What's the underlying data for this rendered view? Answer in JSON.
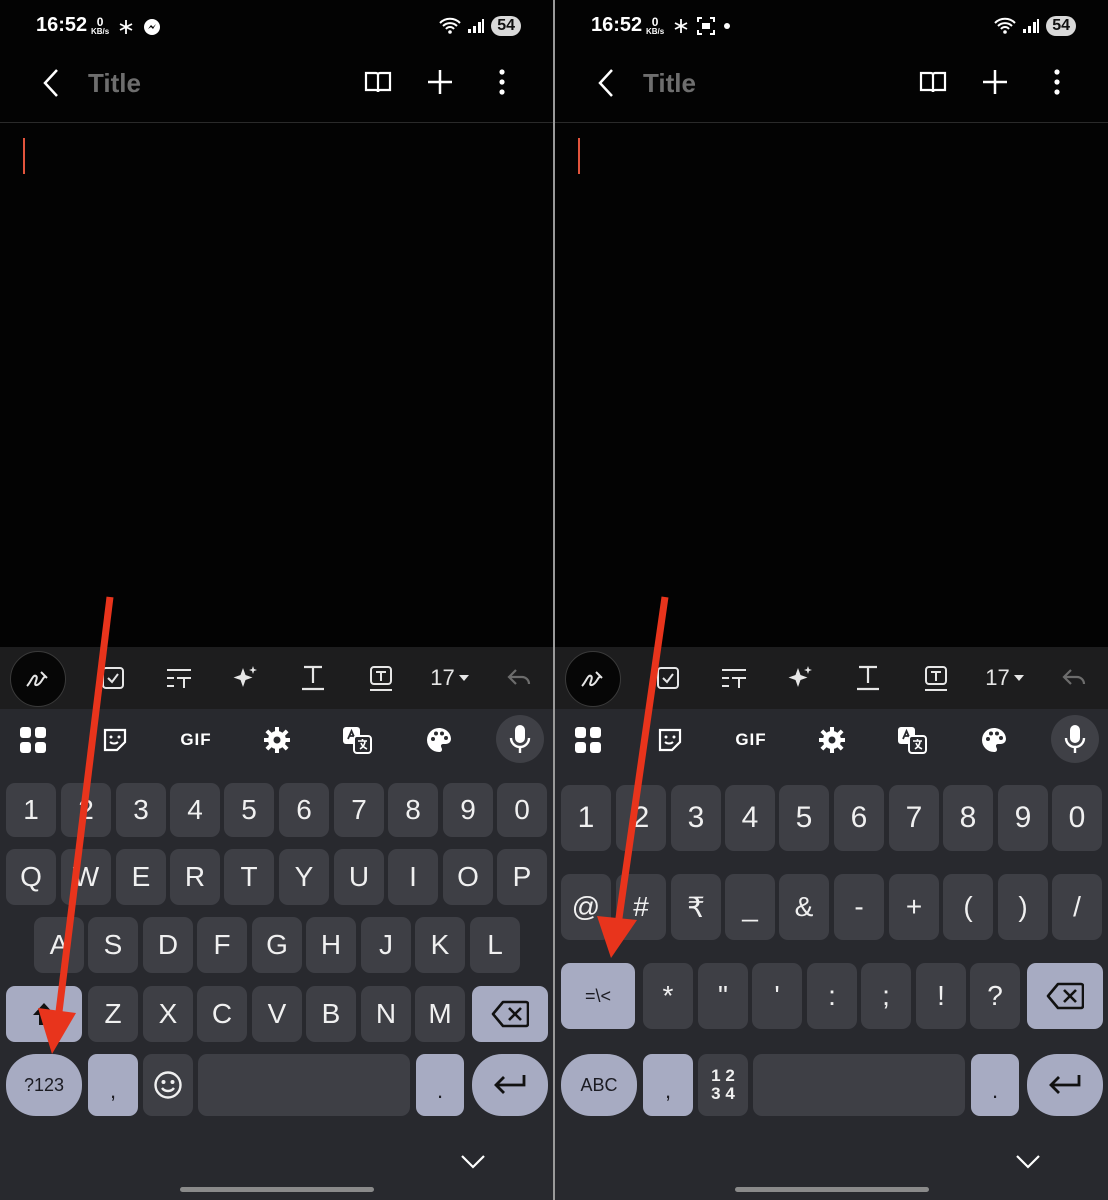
{
  "panels": [
    {
      "status": {
        "time": "16:52",
        "speed_value": "0",
        "speed_unit": "KB/s",
        "battery": "54"
      },
      "app_bar": {
        "title": "Title"
      },
      "toolbar": {
        "font_size": "17"
      },
      "kb_toolbar": {
        "gif_label": "GIF"
      },
      "keyboard_layout": "alphabet",
      "rows": {
        "numbers": [
          "1",
          "2",
          "3",
          "4",
          "5",
          "6",
          "7",
          "8",
          "9",
          "0"
        ],
        "row1": [
          "Q",
          "W",
          "E",
          "R",
          "T",
          "Y",
          "U",
          "I",
          "O",
          "P"
        ],
        "row2": [
          "A",
          "S",
          "D",
          "F",
          "G",
          "H",
          "J",
          "K",
          "L"
        ],
        "row3": [
          "Z",
          "X",
          "C",
          "V",
          "B",
          "N",
          "M"
        ]
      },
      "bottom": {
        "mode_key": "?123",
        "comma": ",",
        "period": "."
      }
    },
    {
      "status": {
        "time": "16:52",
        "speed_value": "0",
        "speed_unit": "KB/s",
        "battery": "54"
      },
      "app_bar": {
        "title": "Title"
      },
      "toolbar": {
        "font_size": "17"
      },
      "kb_toolbar": {
        "gif_label": "GIF"
      },
      "keyboard_layout": "symbols",
      "rows": {
        "numbers": [
          "1",
          "2",
          "3",
          "4",
          "5",
          "6",
          "7",
          "8",
          "9",
          "0"
        ],
        "row1": [
          "@",
          "#",
          "₹",
          "_",
          "&",
          "-",
          "+",
          "(",
          ")",
          "/"
        ],
        "row2": [
          "*",
          "\"",
          "'",
          ":",
          ";",
          "!",
          "?"
        ]
      },
      "bottom": {
        "mode_key": "ABC",
        "shift_key": "=\\<",
        "comma": ",",
        "numpad_top": "1 2",
        "numpad_bottom": "3 4",
        "period": "."
      }
    }
  ],
  "colors": {
    "accent_arrow": "#e8341c",
    "cursor": "#e2543c",
    "function_key": "#a7abc2",
    "key": "#3e3f45",
    "keyboard_bg": "#28292e"
  },
  "icons": [
    "back-chevron-icon",
    "reader-mode-icon",
    "add-icon",
    "more-vert-icon",
    "pen-icon",
    "checkbox-icon",
    "text-style-icon",
    "sparkle-icon",
    "text-underline-icon",
    "text-box-icon",
    "undo-icon",
    "apps-grid-icon",
    "sticker-icon",
    "settings-gear-icon",
    "translate-icon",
    "palette-icon",
    "microphone-icon",
    "shift-icon",
    "backspace-icon",
    "emoji-icon",
    "enter-icon",
    "chevron-down-icon"
  ]
}
